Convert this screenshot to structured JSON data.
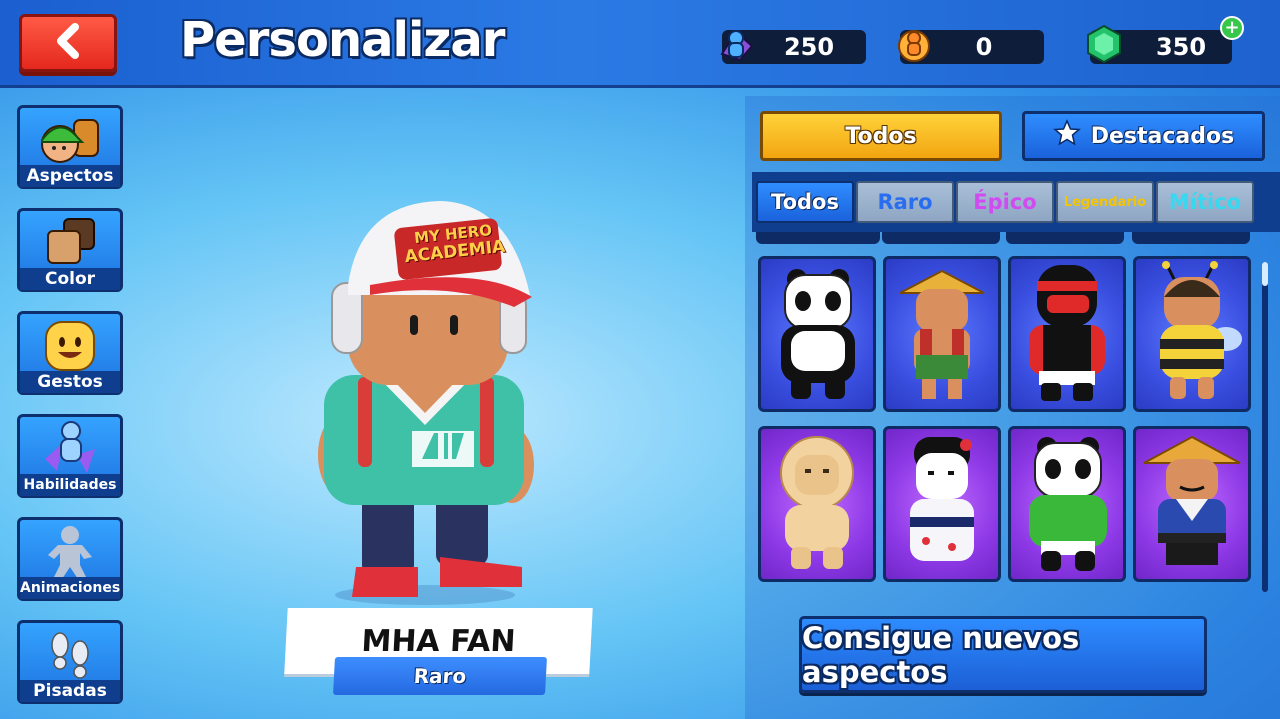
{
  "header": {
    "title": "Personalizar",
    "back_icon": "chevron-left-icon",
    "currencies": [
      {
        "name": "stumble-tokens",
        "icon": "blue-figure-icon",
        "value": "250"
      },
      {
        "name": "gold-tokens",
        "icon": "orange-figure-icon",
        "value": "0"
      },
      {
        "name": "gems",
        "icon": "gem-icon",
        "value": "350"
      }
    ],
    "add_label": "+"
  },
  "sidebar": {
    "items": [
      {
        "label": "Aspectos",
        "icon": "character-head-icon"
      },
      {
        "label": "Color",
        "icon": "color-swatch-icon"
      },
      {
        "label": "Gestos",
        "icon": "smiley-face-icon"
      },
      {
        "label": "Habilidades",
        "icon": "ability-figure-icon"
      },
      {
        "label": "Animaciones",
        "icon": "pose-figure-icon"
      },
      {
        "label": "Pisadas",
        "icon": "footprints-icon"
      }
    ]
  },
  "preview": {
    "cap_text_line1": "MY HERO",
    "cap_text_line2": "ACADEMIA",
    "skin_name": "MHA FAN",
    "rarity": "Raro"
  },
  "tabs": {
    "all": "Todos",
    "featured": "Destacados"
  },
  "filters": [
    {
      "label": "Todos",
      "color": "#ffffff"
    },
    {
      "label": "Raro",
      "color": "#2a6ef0"
    },
    {
      "label": "Épico",
      "color": "#d04bf0"
    },
    {
      "label": "Legendario",
      "color": "#f5c400"
    },
    {
      "label": "Mítico",
      "color": "#38d8f0"
    }
  ],
  "skins": [
    {
      "id": "panda",
      "rarity_color": "blue"
    },
    {
      "id": "straw-hat-farmer",
      "rarity_color": "blue"
    },
    {
      "id": "racer",
      "rarity_color": "blue"
    },
    {
      "id": "bee",
      "rarity_color": "blue"
    },
    {
      "id": "lion",
      "rarity_color": "purple"
    },
    {
      "id": "geisha",
      "rarity_color": "purple"
    },
    {
      "id": "panda-hoodie",
      "rarity_color": "purple"
    },
    {
      "id": "samurai",
      "rarity_color": "purple"
    }
  ],
  "cta": {
    "label": "Consigue nuevos aspectos"
  }
}
